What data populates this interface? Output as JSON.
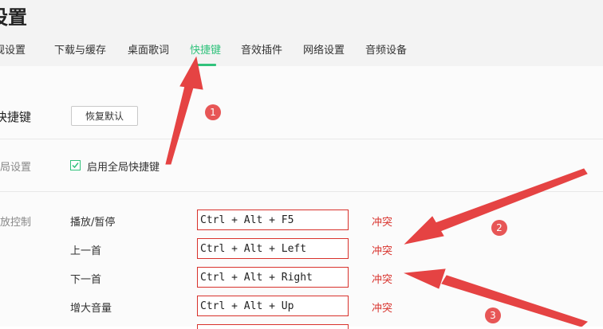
{
  "window": {
    "title": "设置"
  },
  "tabs": [
    {
      "label": "常规设置",
      "active": false
    },
    {
      "label": "下载与缓存",
      "active": false
    },
    {
      "label": "桌面歌词",
      "active": false
    },
    {
      "label": "快捷键",
      "active": true
    },
    {
      "label": "音效插件",
      "active": false
    },
    {
      "label": "网络设置",
      "active": false
    },
    {
      "label": "音频设备",
      "active": false
    }
  ],
  "shortcut": {
    "section_label": "快捷键",
    "restore_button": "恢复默认"
  },
  "global": {
    "section_label": "全局设置",
    "checkbox_label": "启用全局快捷键",
    "checked": true
  },
  "playback": {
    "section_label": "播放控制",
    "items": [
      {
        "name": "播放/暂停",
        "hotkey": "Ctrl + Alt + F5",
        "status": "冲突"
      },
      {
        "name": "上一首",
        "hotkey": "Ctrl + Alt + Left",
        "status": "冲突"
      },
      {
        "name": "下一首",
        "hotkey": "Ctrl + Alt + Right",
        "status": "冲突"
      },
      {
        "name": "增大音量",
        "hotkey": "Ctrl + Alt + Up",
        "status": "冲突"
      }
    ]
  },
  "annotations": {
    "badge_1": "1",
    "badge_2": "2",
    "badge_3": "3"
  },
  "colors": {
    "accent": "#31c27c",
    "conflict": "#d8322c",
    "annotation": "#e43a3a"
  }
}
